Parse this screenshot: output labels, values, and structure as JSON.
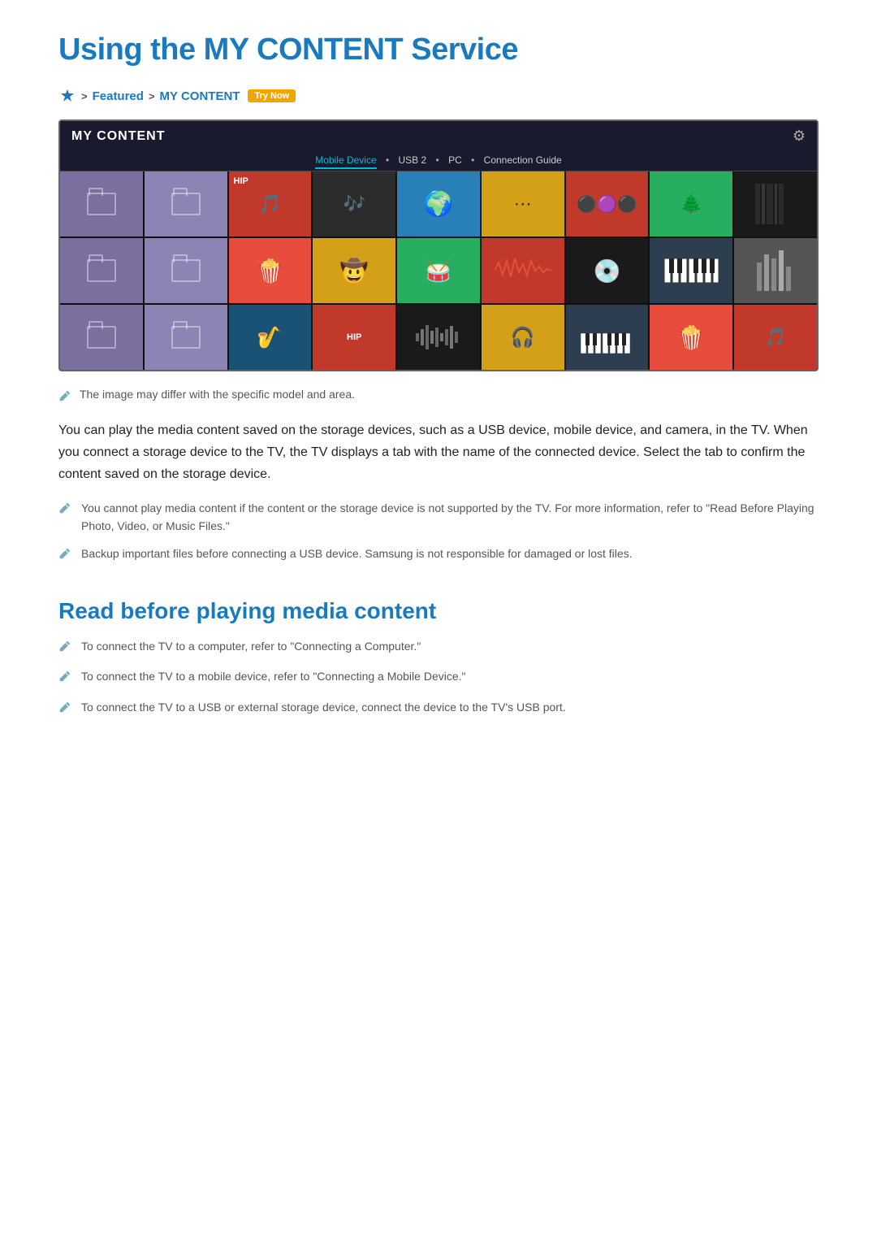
{
  "page": {
    "title": "Using the MY CONTENT Service",
    "breadcrumb": {
      "icon": "settings-icon",
      "separator1": ">",
      "featured": "Featured",
      "separator2": ">",
      "mycontent": "MY CONTENT",
      "trynow": "Try Now"
    },
    "panel": {
      "title": "MY CONTENT",
      "tabs": {
        "mobile": "Mobile Device",
        "usb": "USB 2",
        "pc": "PC",
        "guide": "Connection Guide"
      },
      "gear_symbol": "⚙"
    },
    "image_note": "The image may differ with the specific model and area.",
    "main_paragraph": "You can play the media content saved on the storage devices, such as a USB device, mobile device, and camera, in the TV. When you connect a storage device to the TV, the TV displays a tab with the name of the connected device. Select the tab to confirm the content saved on the storage device.",
    "notes": [
      "You cannot play media content if the content or the storage device is not supported by the TV. For more information, refer to \"Read Before Playing Photo, Video, or Music Files.\"",
      "Backup important files before connecting a USB device. Samsung is not responsible for damaged or lost files."
    ],
    "section2_title": "Read before playing media content",
    "section2_items": [
      "To connect the TV to a computer, refer to \"Connecting a Computer.\"",
      "To connect the TV to a mobile device, refer to \"Connecting a Mobile Device.\"",
      "To connect the TV to a USB or external storage device, connect the device to the TV's USB port."
    ]
  }
}
